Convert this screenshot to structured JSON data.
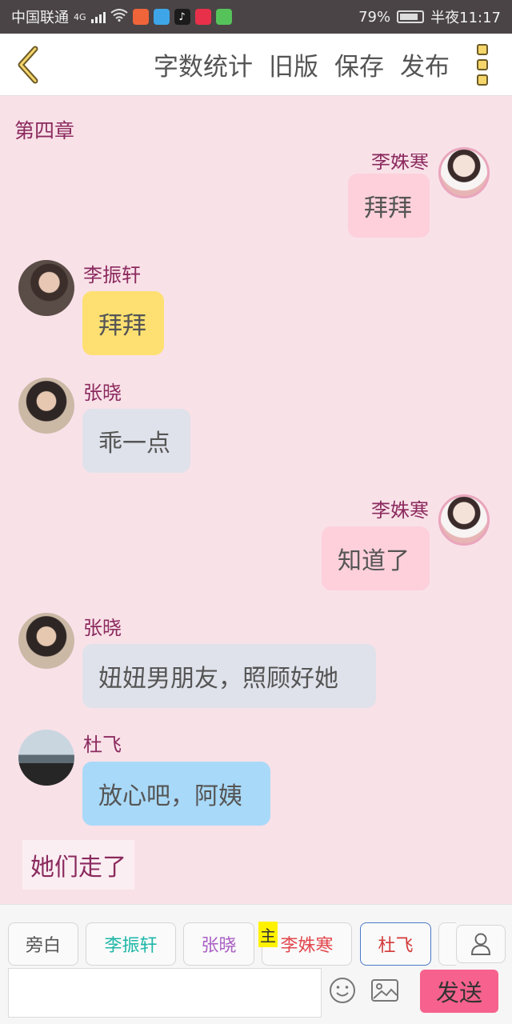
{
  "status_bar": {
    "carrier": "中国联通",
    "network": "4G",
    "battery": "79%",
    "time": "半夜11:17",
    "icons": [
      "signal-icon",
      "wifi-icon",
      "app-icon",
      "app-icon",
      "tiktok-icon",
      "app-icon",
      "app-icon",
      "battery-icon"
    ]
  },
  "toolbar": {
    "back_icon": "chevron-left-icon",
    "word_count": "字数统计",
    "old_version": "旧版",
    "save": "保存",
    "publish": "发布",
    "more_icon": "more-vertical-icon"
  },
  "chapter_title": "第四章",
  "messages": [
    {
      "side": "right",
      "name": "李姝寒",
      "text": "拜拜",
      "color": "#fdd0db"
    },
    {
      "side": "left",
      "name": "李振轩",
      "text": "拜拜",
      "color": "#fde071"
    },
    {
      "side": "left",
      "name": "张晓",
      "text": "乖一点",
      "color": "#dfe2ea"
    },
    {
      "side": "right",
      "name": "李姝寒",
      "text": "知道了",
      "color": "#fdd0db"
    },
    {
      "side": "left",
      "name": "张晓",
      "text": "妞妞男朋友，照顾好她",
      "color": "#dfe2ea"
    },
    {
      "side": "left",
      "name": "杜飞",
      "text": "放心吧，阿姨",
      "color": "#a9d9f8"
    }
  ],
  "narration": "她们走了",
  "characters": [
    {
      "label": "旁白",
      "color": "#555555"
    },
    {
      "label": "李振轩",
      "color": "#1fb7a8"
    },
    {
      "label": "张晓",
      "color": "#a95fc4"
    },
    {
      "label": "李姝寒",
      "color": "#e2484e",
      "badge": "主"
    },
    {
      "label": "杜飞",
      "color": "#d33a3a",
      "selected_border": "#4a78c8"
    }
  ],
  "input_placeholder": "",
  "emoji_icon": "smiley-icon",
  "image_icon": "image-icon",
  "user_icon": "user-icon",
  "send_label": "发送"
}
